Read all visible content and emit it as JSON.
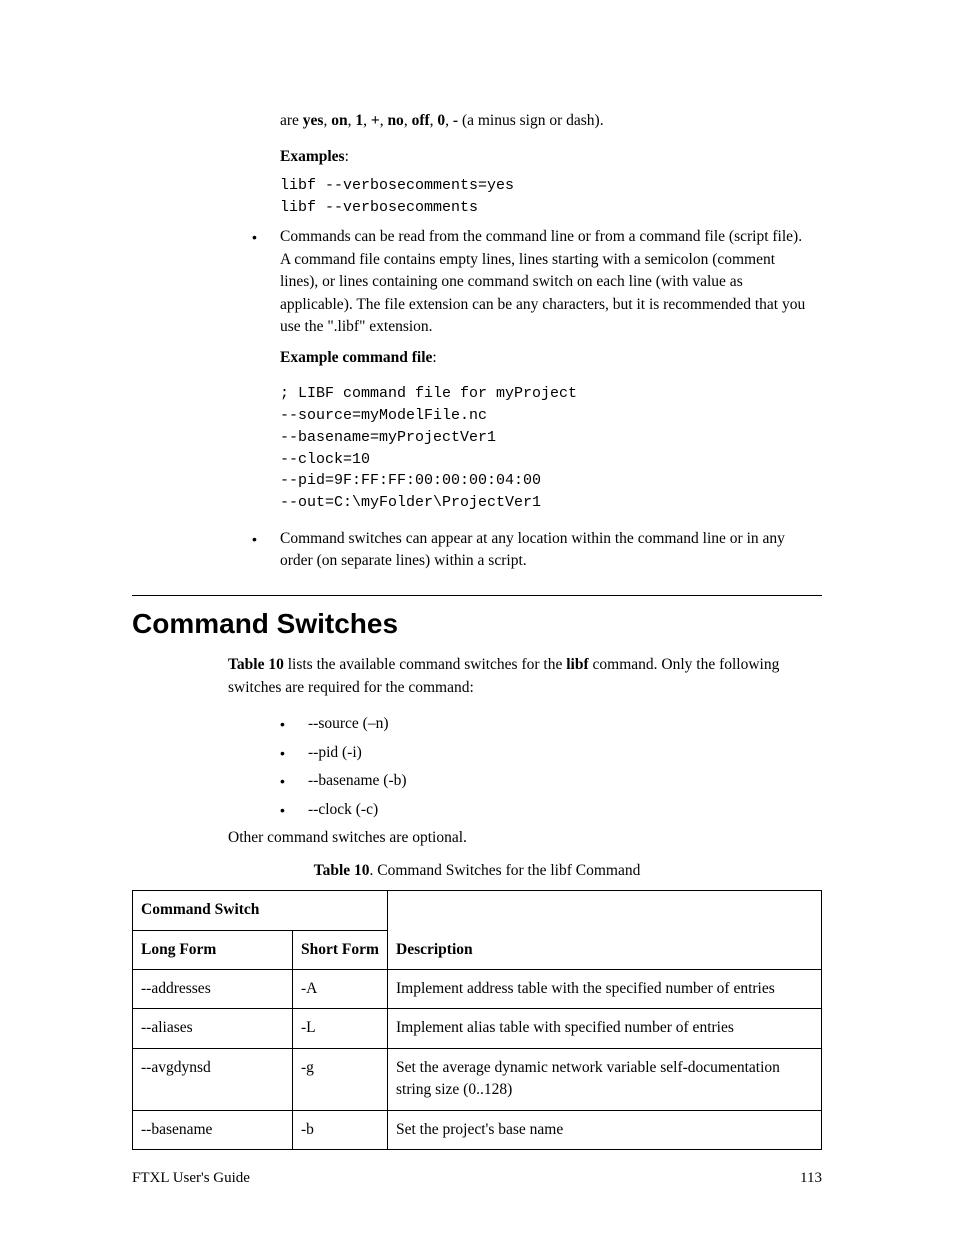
{
  "top": {
    "intro_prefix": "are ",
    "vals": [
      "yes",
      "on",
      "1",
      "+",
      "no",
      "off",
      "0",
      "-"
    ],
    "intro_suffix": " (a minus sign or dash).",
    "examples_label": "Examples",
    "ex1": "libf --verbosecomments=yes",
    "ex2": "libf --verbosecomments"
  },
  "bullets": {
    "b1": "Commands can be read from the command line or from a command file (script file).  A command file contains empty lines, lines starting with a semicolon (comment lines), or lines containing one command switch on each line (with value as applicable).  The file extension can be any characters, but it is recommended that you use the \".libf\" extension.",
    "ex_label": "Example command file",
    "code": "; LIBF command file for myProject\n--source=myModelFile.nc\n--basename=myProjectVer1\n--clock=10\n--pid=9F:FF:FF:00:00:00:04:00\n--out=C:\\myFolder\\ProjectVer1",
    "b2": "Command switches can appear at any location within the command line or in any order (on separate lines) within a script."
  },
  "section_title": "Command Switches",
  "intro": {
    "p1_a": "Table 10",
    "p1_b": " lists the available command switches for the ",
    "p1_c": "libf",
    "p1_d": " command.  Only the following switches are required for the command:",
    "switches": [
      "--source (–n)",
      "--pid (-i)",
      "--basename (-b)",
      "--clock (-c)"
    ],
    "p2": "Other command switches are optional."
  },
  "table": {
    "caption_a": "Table 10",
    "caption_b": ". Command Switches for the libf Command",
    "h_cmdswitch": "Command Switch",
    "h_long": "Long Form",
    "h_short": "Short Form",
    "h_desc": "Description",
    "rows": [
      {
        "long": "--addresses",
        "short": "-A",
        "desc": "Implement address table with the specified number of entries"
      },
      {
        "long": "--aliases",
        "short": "-L",
        "desc": "Implement alias table with specified number of entries"
      },
      {
        "long": "--avgdynsd",
        "short": "-g",
        "desc": "Set the average dynamic network variable self-documentation string size (0..128)"
      },
      {
        "long": "--basename",
        "short": "-b",
        "desc": "Set the project's base name"
      }
    ]
  },
  "footer": {
    "left": "FTXL User's Guide",
    "right": "113"
  }
}
